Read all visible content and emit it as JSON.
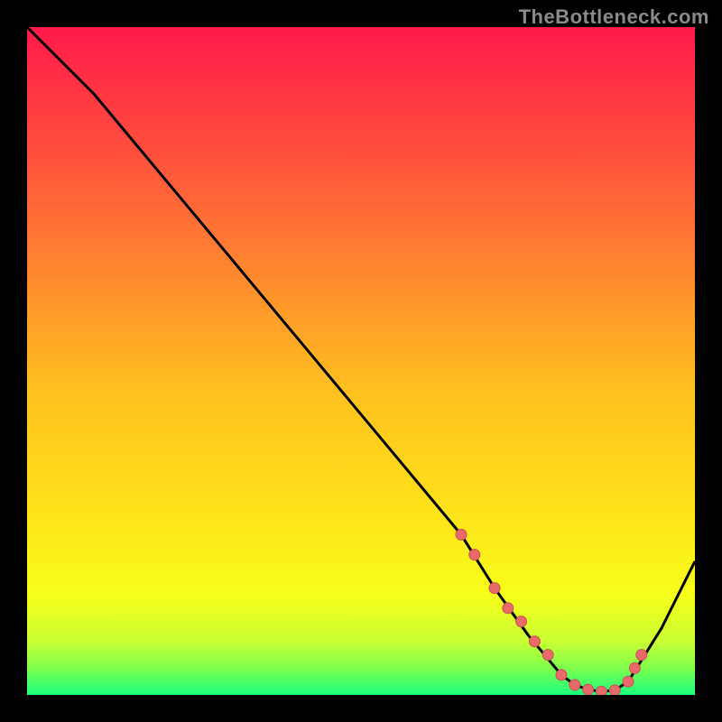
{
  "watermark": "TheBottleneck.com",
  "chart_data": {
    "type": "line",
    "title": "",
    "xlabel": "",
    "ylabel": "",
    "xlim": [
      0,
      100
    ],
    "ylim": [
      0,
      100
    ],
    "grid": false,
    "legend": false,
    "series": [
      {
        "name": "curve",
        "x": [
          0,
          3,
          10,
          20,
          30,
          40,
          50,
          60,
          65,
          70,
          75,
          80,
          82,
          84,
          86,
          88,
          90,
          95,
          100
        ],
        "y": [
          100,
          97,
          90,
          78,
          66,
          54,
          42,
          30,
          24,
          16,
          9,
          3,
          1.5,
          0.8,
          0.5,
          0.7,
          2,
          10,
          20
        ]
      }
    ],
    "markers": {
      "name": "highlight-dots",
      "x": [
        65,
        67,
        70,
        72,
        74,
        76,
        78,
        80,
        82,
        84,
        86,
        88,
        90,
        91,
        92
      ],
      "y": [
        24,
        21,
        16,
        13,
        11,
        8,
        6,
        3,
        1.5,
        0.8,
        0.5,
        0.7,
        2,
        4,
        6
      ]
    },
    "gradient_stops": [
      {
        "offset": 0,
        "color": "#ff1a4b"
      },
      {
        "offset": 18,
        "color": "#ff4d3d"
      },
      {
        "offset": 38,
        "color": "#ff8c2e"
      },
      {
        "offset": 55,
        "color": "#ffc21f"
      },
      {
        "offset": 72,
        "color": "#ffe11a"
      },
      {
        "offset": 85,
        "color": "#f7ff1a"
      },
      {
        "offset": 92,
        "color": "#c9ff33"
      },
      {
        "offset": 96,
        "color": "#7dff4d"
      },
      {
        "offset": 100,
        "color": "#1aff7d"
      }
    ],
    "colors": {
      "curve": "#000000",
      "marker_fill": "#e86a6a",
      "marker_stroke": "#c94f4f"
    }
  }
}
